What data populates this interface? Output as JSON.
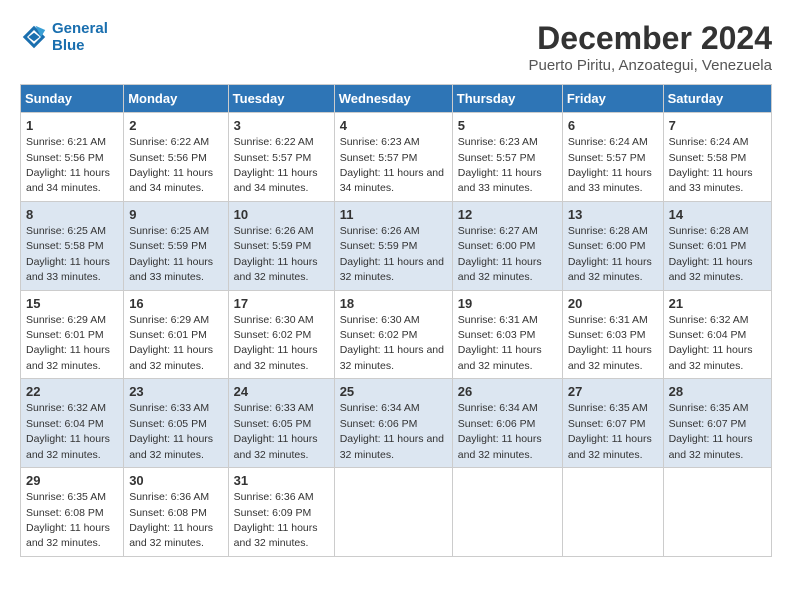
{
  "header": {
    "logo_line1": "General",
    "logo_line2": "Blue",
    "title": "December 2024",
    "subtitle": "Puerto Piritu, Anzoategui, Venezuela"
  },
  "days_of_week": [
    "Sunday",
    "Monday",
    "Tuesday",
    "Wednesday",
    "Thursday",
    "Friday",
    "Saturday"
  ],
  "weeks": [
    [
      {
        "day": "1",
        "info": "Sunrise: 6:21 AM\nSunset: 5:56 PM\nDaylight: 11 hours and 34 minutes."
      },
      {
        "day": "2",
        "info": "Sunrise: 6:22 AM\nSunset: 5:56 PM\nDaylight: 11 hours and 34 minutes."
      },
      {
        "day": "3",
        "info": "Sunrise: 6:22 AM\nSunset: 5:57 PM\nDaylight: 11 hours and 34 minutes."
      },
      {
        "day": "4",
        "info": "Sunrise: 6:23 AM\nSunset: 5:57 PM\nDaylight: 11 hours and 34 minutes."
      },
      {
        "day": "5",
        "info": "Sunrise: 6:23 AM\nSunset: 5:57 PM\nDaylight: 11 hours and 33 minutes."
      },
      {
        "day": "6",
        "info": "Sunrise: 6:24 AM\nSunset: 5:57 PM\nDaylight: 11 hours and 33 minutes."
      },
      {
        "day": "7",
        "info": "Sunrise: 6:24 AM\nSunset: 5:58 PM\nDaylight: 11 hours and 33 minutes."
      }
    ],
    [
      {
        "day": "8",
        "info": "Sunrise: 6:25 AM\nSunset: 5:58 PM\nDaylight: 11 hours and 33 minutes."
      },
      {
        "day": "9",
        "info": "Sunrise: 6:25 AM\nSunset: 5:59 PM\nDaylight: 11 hours and 33 minutes."
      },
      {
        "day": "10",
        "info": "Sunrise: 6:26 AM\nSunset: 5:59 PM\nDaylight: 11 hours and 32 minutes."
      },
      {
        "day": "11",
        "info": "Sunrise: 6:26 AM\nSunset: 5:59 PM\nDaylight: 11 hours and 32 minutes."
      },
      {
        "day": "12",
        "info": "Sunrise: 6:27 AM\nSunset: 6:00 PM\nDaylight: 11 hours and 32 minutes."
      },
      {
        "day": "13",
        "info": "Sunrise: 6:28 AM\nSunset: 6:00 PM\nDaylight: 11 hours and 32 minutes."
      },
      {
        "day": "14",
        "info": "Sunrise: 6:28 AM\nSunset: 6:01 PM\nDaylight: 11 hours and 32 minutes."
      }
    ],
    [
      {
        "day": "15",
        "info": "Sunrise: 6:29 AM\nSunset: 6:01 PM\nDaylight: 11 hours and 32 minutes."
      },
      {
        "day": "16",
        "info": "Sunrise: 6:29 AM\nSunset: 6:01 PM\nDaylight: 11 hours and 32 minutes."
      },
      {
        "day": "17",
        "info": "Sunrise: 6:30 AM\nSunset: 6:02 PM\nDaylight: 11 hours and 32 minutes."
      },
      {
        "day": "18",
        "info": "Sunrise: 6:30 AM\nSunset: 6:02 PM\nDaylight: 11 hours and 32 minutes."
      },
      {
        "day": "19",
        "info": "Sunrise: 6:31 AM\nSunset: 6:03 PM\nDaylight: 11 hours and 32 minutes."
      },
      {
        "day": "20",
        "info": "Sunrise: 6:31 AM\nSunset: 6:03 PM\nDaylight: 11 hours and 32 minutes."
      },
      {
        "day": "21",
        "info": "Sunrise: 6:32 AM\nSunset: 6:04 PM\nDaylight: 11 hours and 32 minutes."
      }
    ],
    [
      {
        "day": "22",
        "info": "Sunrise: 6:32 AM\nSunset: 6:04 PM\nDaylight: 11 hours and 32 minutes."
      },
      {
        "day": "23",
        "info": "Sunrise: 6:33 AM\nSunset: 6:05 PM\nDaylight: 11 hours and 32 minutes."
      },
      {
        "day": "24",
        "info": "Sunrise: 6:33 AM\nSunset: 6:05 PM\nDaylight: 11 hours and 32 minutes."
      },
      {
        "day": "25",
        "info": "Sunrise: 6:34 AM\nSunset: 6:06 PM\nDaylight: 11 hours and 32 minutes."
      },
      {
        "day": "26",
        "info": "Sunrise: 6:34 AM\nSunset: 6:06 PM\nDaylight: 11 hours and 32 minutes."
      },
      {
        "day": "27",
        "info": "Sunrise: 6:35 AM\nSunset: 6:07 PM\nDaylight: 11 hours and 32 minutes."
      },
      {
        "day": "28",
        "info": "Sunrise: 6:35 AM\nSunset: 6:07 PM\nDaylight: 11 hours and 32 minutes."
      }
    ],
    [
      {
        "day": "29",
        "info": "Sunrise: 6:35 AM\nSunset: 6:08 PM\nDaylight: 11 hours and 32 minutes."
      },
      {
        "day": "30",
        "info": "Sunrise: 6:36 AM\nSunset: 6:08 PM\nDaylight: 11 hours and 32 minutes."
      },
      {
        "day": "31",
        "info": "Sunrise: 6:36 AM\nSunset: 6:09 PM\nDaylight: 11 hours and 32 minutes."
      },
      {
        "day": "",
        "info": ""
      },
      {
        "day": "",
        "info": ""
      },
      {
        "day": "",
        "info": ""
      },
      {
        "day": "",
        "info": ""
      }
    ]
  ]
}
